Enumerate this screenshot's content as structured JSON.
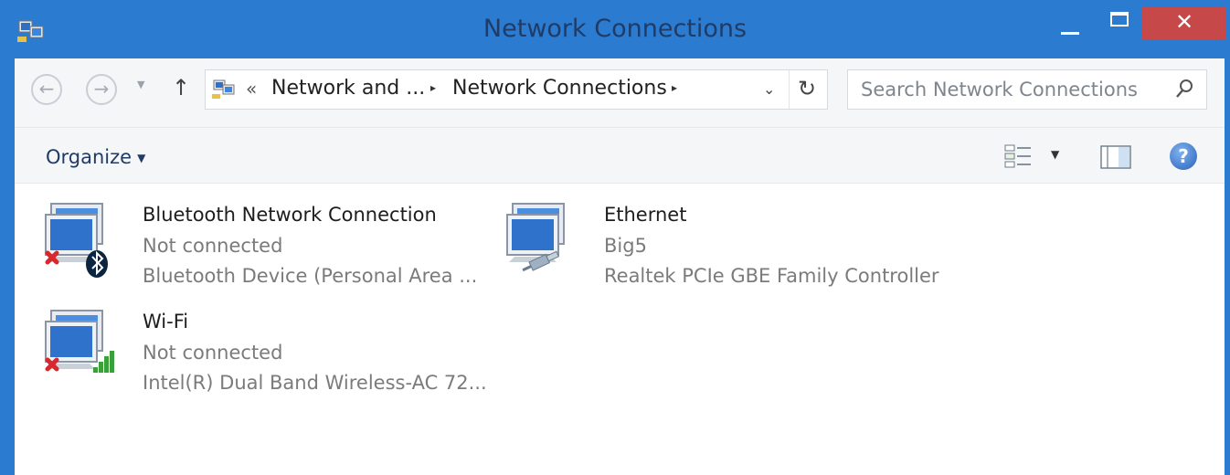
{
  "window": {
    "title": "Network Connections",
    "close_glyph": "✕"
  },
  "address_bar": {
    "chevron": "«",
    "crumbs": [
      "Network and ...",
      "Network Connections"
    ],
    "separator_glyph": "▸",
    "dropdown_glyph": "⌄",
    "refresh_glyph": "↻"
  },
  "search": {
    "placeholder": "Search Network Connections"
  },
  "toolbar": {
    "organize_label": "Organize"
  },
  "connections": [
    {
      "name": "Bluetooth Network Connection",
      "status": "Not connected",
      "device": "Bluetooth Device (Personal Area ...",
      "type": "bluetooth",
      "disconnected": true
    },
    {
      "name": "Ethernet",
      "status": "Big5",
      "device": "Realtek PCIe GBE Family Controller",
      "type": "ethernet",
      "disconnected": false
    },
    {
      "name": "Wi-Fi",
      "status": "Not connected",
      "device": "Intel(R) Dual Band Wireless-AC 72...",
      "type": "wifi",
      "disconnected": true
    }
  ],
  "icons": {
    "app": "network-connections-icon",
    "back": "back-arrow-icon",
    "forward": "forward-arrow-icon",
    "up": "up-arrow-icon",
    "search": "search-icon",
    "views": "change-view-icon",
    "preview": "preview-pane-icon",
    "help": "help-icon"
  },
  "colors": {
    "title_bar": "#2b7bd0",
    "close_button": "#c74848",
    "disconnected_x": "#d8282e",
    "wifi_bars": "#3aa03a"
  }
}
